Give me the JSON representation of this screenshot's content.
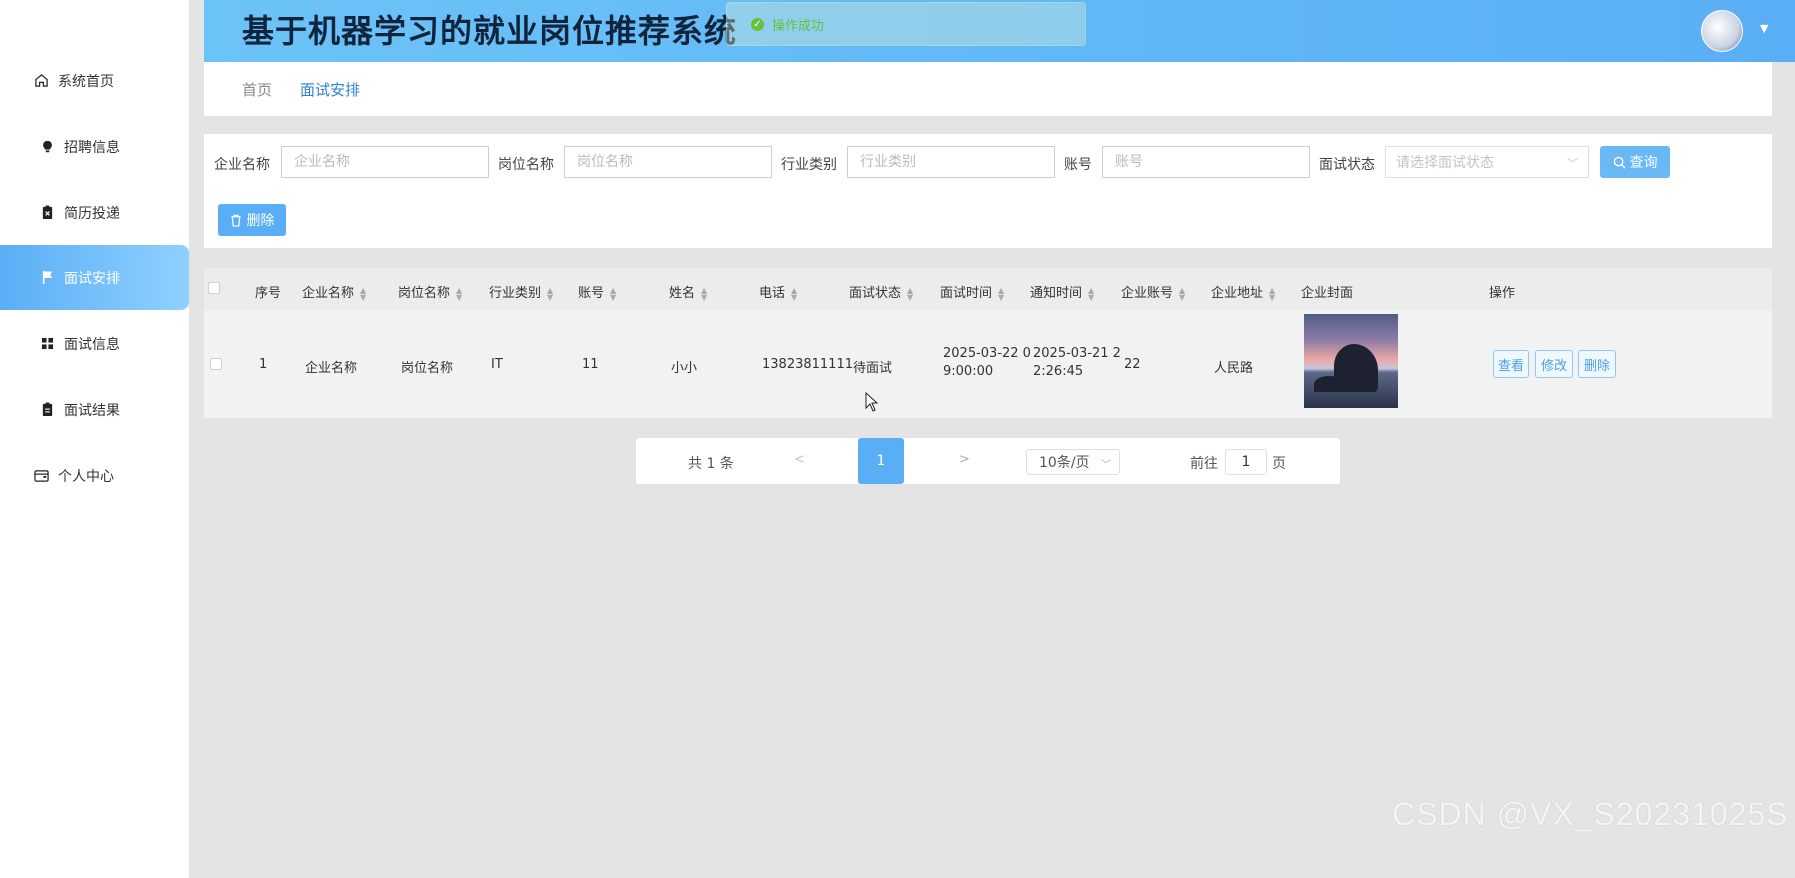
{
  "header": {
    "title": "基于机器学习的就业岗位推荐系统",
    "toast": "操作成功"
  },
  "sidebar": {
    "items": [
      {
        "label": "系统首页",
        "icon": "home-icon"
      },
      {
        "label": "招聘信息",
        "icon": "bulb-icon"
      },
      {
        "label": "简历投递",
        "icon": "clipboard-x-icon"
      },
      {
        "label": "面试安排",
        "icon": "flag-icon",
        "active": true
      },
      {
        "label": "面试信息",
        "icon": "grid-icon"
      },
      {
        "label": "面试结果",
        "icon": "clipboard-icon"
      },
      {
        "label": "个人中心",
        "icon": "wallet-icon"
      }
    ]
  },
  "breadcrumb": {
    "home": "首页",
    "current": "面试安排"
  },
  "search": {
    "company_label": "企业名称",
    "company_placeholder": "企业名称",
    "position_label": "岗位名称",
    "position_placeholder": "岗位名称",
    "industry_label": "行业类别",
    "industry_placeholder": "行业类别",
    "account_label": "账号",
    "account_placeholder": "账号",
    "status_label": "面试状态",
    "status_placeholder": "请选择面试状态",
    "query_button": "查询",
    "delete_button": "删除"
  },
  "table": {
    "headers": {
      "index": "序号",
      "company": "企业名称",
      "position": "岗位名称",
      "industry": "行业类别",
      "account": "账号",
      "name": "姓名",
      "phone": "电话",
      "status": "面试状态",
      "interview_time": "面试时间",
      "notify_time": "通知时间",
      "company_account": "企业账号",
      "company_address": "企业地址",
      "cover": "企业封面",
      "actions": "操作"
    },
    "rows": [
      {
        "index": "1",
        "company": "企业名称",
        "position": "岗位名称",
        "industry": "IT",
        "account": "11",
        "name": "小小",
        "phone": "13823811111",
        "status": "待面试",
        "interview_time_l1": "2025-03-22 0",
        "interview_time_l2": "9:00:00",
        "notify_time_l1": "2025-03-21 2",
        "notify_time_l2": "2:26:45",
        "company_account": "22",
        "company_address": "人民路",
        "view": "查看",
        "edit": "修改",
        "delete": "删除"
      }
    ]
  },
  "pagination": {
    "total": "共 1 条",
    "prev": "<",
    "current_page": "1",
    "next": ">",
    "page_size": "10条/页",
    "goto_label": "前往",
    "goto_value": "1",
    "goto_unit": "页"
  },
  "watermark": "CSDN @VX_S20231025S",
  "colors": {
    "accent": "#5aaef5",
    "header_start": "#6cc3f7",
    "success": "#67c23a"
  }
}
